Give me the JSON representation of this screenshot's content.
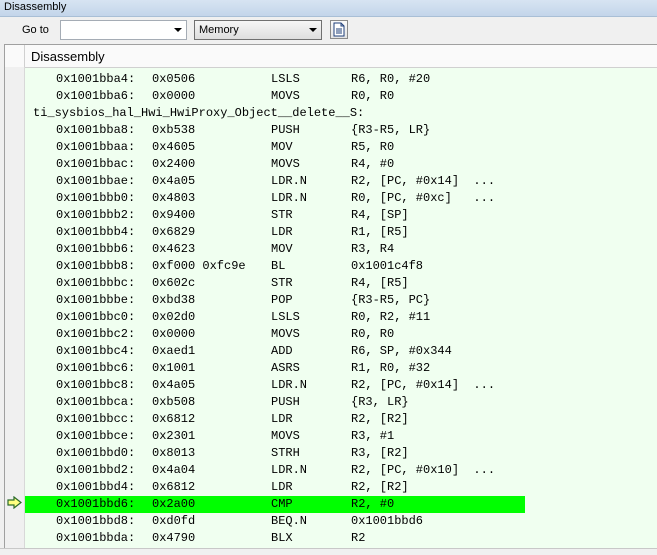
{
  "window": {
    "title": "Disassembly"
  },
  "toolbar": {
    "goto_label": "Go to",
    "goto_value": "",
    "memory_value": "Memory",
    "icon": "document-icon"
  },
  "panel": {
    "header": "Disassembly"
  },
  "rows": [
    {
      "type": "instr",
      "addr": "0x1001bba4:",
      "op": "0x0506",
      "mn": "LSLS",
      "args": "R6, R0, #20"
    },
    {
      "type": "instr",
      "addr": "0x1001bba6:",
      "op": "0x0000",
      "mn": "MOVS",
      "args": "R0, R0"
    },
    {
      "type": "label",
      "text": "ti_sysbios_hal_Hwi_HwiProxy_Object__delete__S:"
    },
    {
      "type": "instr",
      "addr": "0x1001bba8:",
      "op": "0xb538",
      "mn": "PUSH",
      "args": "{R3-R5, LR}"
    },
    {
      "type": "instr",
      "addr": "0x1001bbaa:",
      "op": "0x4605",
      "mn": "MOV",
      "args": "R5, R0"
    },
    {
      "type": "instr",
      "addr": "0x1001bbac:",
      "op": "0x2400",
      "mn": "MOVS",
      "args": "R4, #0"
    },
    {
      "type": "instr",
      "addr": "0x1001bbae:",
      "op": "0x4a05",
      "mn": "LDR.N",
      "args": "R2, [PC, #0x14]  ..."
    },
    {
      "type": "instr",
      "addr": "0x1001bbb0:",
      "op": "0x4803",
      "mn": "LDR.N",
      "args": "R0, [PC, #0xc]   ..."
    },
    {
      "type": "instr",
      "addr": "0x1001bbb2:",
      "op": "0x9400",
      "mn": "STR",
      "args": "R4, [SP]"
    },
    {
      "type": "instr",
      "addr": "0x1001bbb4:",
      "op": "0x6829",
      "mn": "LDR",
      "args": "R1, [R5]"
    },
    {
      "type": "instr",
      "addr": "0x1001bbb6:",
      "op": "0x4623",
      "mn": "MOV",
      "args": "R3, R4"
    },
    {
      "type": "instr",
      "addr": "0x1001bbb8:",
      "op": "0xf000 0xfc9e",
      "mn": "BL",
      "args": "0x1001c4f8"
    },
    {
      "type": "instr",
      "addr": "0x1001bbbc:",
      "op": "0x602c",
      "mn": "STR",
      "args": "R4, [R5]"
    },
    {
      "type": "instr",
      "addr": "0x1001bbbe:",
      "op": "0xbd38",
      "mn": "POP",
      "args": "{R3-R5, PC}"
    },
    {
      "type": "instr",
      "addr": "0x1001bbc0:",
      "op": "0x02d0",
      "mn": "LSLS",
      "args": "R0, R2, #11"
    },
    {
      "type": "instr",
      "addr": "0x1001bbc2:",
      "op": "0x0000",
      "mn": "MOVS",
      "args": "R0, R0"
    },
    {
      "type": "instr",
      "addr": "0x1001bbc4:",
      "op": "0xaed1",
      "mn": "ADD",
      "args": "R6, SP, #0x344"
    },
    {
      "type": "instr",
      "addr": "0x1001bbc6:",
      "op": "0x1001",
      "mn": "ASRS",
      "args": "R1, R0, #32"
    },
    {
      "type": "instr",
      "addr": "0x1001bbc8:",
      "op": "0x4a05",
      "mn": "LDR.N",
      "args": "R2, [PC, #0x14]  ..."
    },
    {
      "type": "instr",
      "addr": "0x1001bbca:",
      "op": "0xb508",
      "mn": "PUSH",
      "args": "{R3, LR}"
    },
    {
      "type": "instr",
      "addr": "0x1001bbcc:",
      "op": "0x6812",
      "mn": "LDR",
      "args": "R2, [R2]"
    },
    {
      "type": "instr",
      "addr": "0x1001bbce:",
      "op": "0x2301",
      "mn": "MOVS",
      "args": "R3, #1"
    },
    {
      "type": "instr",
      "addr": "0x1001bbd0:",
      "op": "0x8013",
      "mn": "STRH",
      "args": "R3, [R2]"
    },
    {
      "type": "instr",
      "addr": "0x1001bbd2:",
      "op": "0x4a04",
      "mn": "LDR.N",
      "args": "R2, [PC, #0x10]  ..."
    },
    {
      "type": "instr",
      "addr": "0x1001bbd4:",
      "op": "0x6812",
      "mn": "LDR",
      "args": "R2, [R2]"
    },
    {
      "type": "instr",
      "addr": "0x1001bbd6:",
      "op": "0x2a00",
      "mn": "CMP",
      "args": "R2, #0",
      "current": true
    },
    {
      "type": "instr",
      "addr": "0x1001bbd8:",
      "op": "0xd0fd",
      "mn": "BEQ.N",
      "args": "0x1001bbd6"
    },
    {
      "type": "instr",
      "addr": "0x1001bbda:",
      "op": "0x4790",
      "mn": "BLX",
      "args": "R2"
    }
  ],
  "colors": {
    "highlight": "#00ff00",
    "panel_bg": "#f0fff0",
    "arrow": "#00b000"
  }
}
